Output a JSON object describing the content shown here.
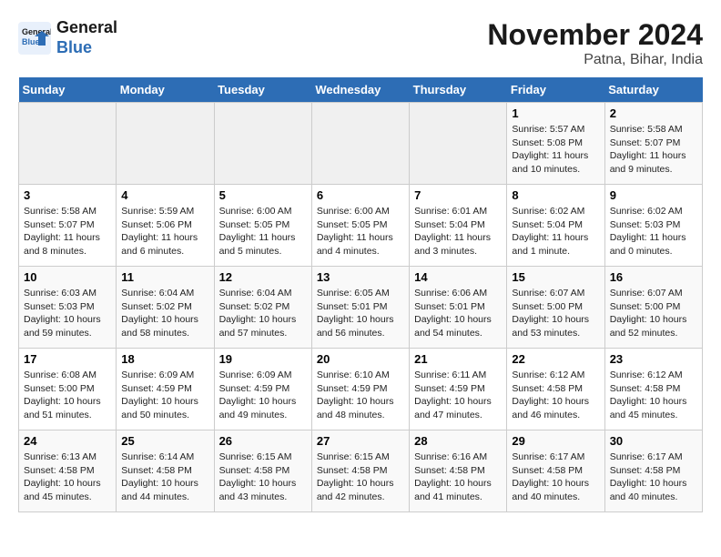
{
  "header": {
    "logo_line1": "General",
    "logo_line2": "Blue",
    "month": "November 2024",
    "location": "Patna, Bihar, India"
  },
  "days_of_week": [
    "Sunday",
    "Monday",
    "Tuesday",
    "Wednesday",
    "Thursday",
    "Friday",
    "Saturday"
  ],
  "weeks": [
    [
      {
        "day": "",
        "empty": true
      },
      {
        "day": "",
        "empty": true
      },
      {
        "day": "",
        "empty": true
      },
      {
        "day": "",
        "empty": true
      },
      {
        "day": "",
        "empty": true
      },
      {
        "day": "1",
        "sunrise": "5:57 AM",
        "sunset": "5:08 PM",
        "daylight": "11 hours and 10 minutes."
      },
      {
        "day": "2",
        "sunrise": "5:58 AM",
        "sunset": "5:07 PM",
        "daylight": "11 hours and 9 minutes."
      }
    ],
    [
      {
        "day": "3",
        "sunrise": "5:58 AM",
        "sunset": "5:07 PM",
        "daylight": "11 hours and 8 minutes."
      },
      {
        "day": "4",
        "sunrise": "5:59 AM",
        "sunset": "5:06 PM",
        "daylight": "11 hours and 6 minutes."
      },
      {
        "day": "5",
        "sunrise": "6:00 AM",
        "sunset": "5:05 PM",
        "daylight": "11 hours and 5 minutes."
      },
      {
        "day": "6",
        "sunrise": "6:00 AM",
        "sunset": "5:05 PM",
        "daylight": "11 hours and 4 minutes."
      },
      {
        "day": "7",
        "sunrise": "6:01 AM",
        "sunset": "5:04 PM",
        "daylight": "11 hours and 3 minutes."
      },
      {
        "day": "8",
        "sunrise": "6:02 AM",
        "sunset": "5:04 PM",
        "daylight": "11 hours and 1 minute."
      },
      {
        "day": "9",
        "sunrise": "6:02 AM",
        "sunset": "5:03 PM",
        "daylight": "11 hours and 0 minutes."
      }
    ],
    [
      {
        "day": "10",
        "sunrise": "6:03 AM",
        "sunset": "5:03 PM",
        "daylight": "10 hours and 59 minutes."
      },
      {
        "day": "11",
        "sunrise": "6:04 AM",
        "sunset": "5:02 PM",
        "daylight": "10 hours and 58 minutes."
      },
      {
        "day": "12",
        "sunrise": "6:04 AM",
        "sunset": "5:02 PM",
        "daylight": "10 hours and 57 minutes."
      },
      {
        "day": "13",
        "sunrise": "6:05 AM",
        "sunset": "5:01 PM",
        "daylight": "10 hours and 56 minutes."
      },
      {
        "day": "14",
        "sunrise": "6:06 AM",
        "sunset": "5:01 PM",
        "daylight": "10 hours and 54 minutes."
      },
      {
        "day": "15",
        "sunrise": "6:07 AM",
        "sunset": "5:00 PM",
        "daylight": "10 hours and 53 minutes."
      },
      {
        "day": "16",
        "sunrise": "6:07 AM",
        "sunset": "5:00 PM",
        "daylight": "10 hours and 52 minutes."
      }
    ],
    [
      {
        "day": "17",
        "sunrise": "6:08 AM",
        "sunset": "5:00 PM",
        "daylight": "10 hours and 51 minutes."
      },
      {
        "day": "18",
        "sunrise": "6:09 AM",
        "sunset": "4:59 PM",
        "daylight": "10 hours and 50 minutes."
      },
      {
        "day": "19",
        "sunrise": "6:09 AM",
        "sunset": "4:59 PM",
        "daylight": "10 hours and 49 minutes."
      },
      {
        "day": "20",
        "sunrise": "6:10 AM",
        "sunset": "4:59 PM",
        "daylight": "10 hours and 48 minutes."
      },
      {
        "day": "21",
        "sunrise": "6:11 AM",
        "sunset": "4:59 PM",
        "daylight": "10 hours and 47 minutes."
      },
      {
        "day": "22",
        "sunrise": "6:12 AM",
        "sunset": "4:58 PM",
        "daylight": "10 hours and 46 minutes."
      },
      {
        "day": "23",
        "sunrise": "6:12 AM",
        "sunset": "4:58 PM",
        "daylight": "10 hours and 45 minutes."
      }
    ],
    [
      {
        "day": "24",
        "sunrise": "6:13 AM",
        "sunset": "4:58 PM",
        "daylight": "10 hours and 45 minutes."
      },
      {
        "day": "25",
        "sunrise": "6:14 AM",
        "sunset": "4:58 PM",
        "daylight": "10 hours and 44 minutes."
      },
      {
        "day": "26",
        "sunrise": "6:15 AM",
        "sunset": "4:58 PM",
        "daylight": "10 hours and 43 minutes."
      },
      {
        "day": "27",
        "sunrise": "6:15 AM",
        "sunset": "4:58 PM",
        "daylight": "10 hours and 42 minutes."
      },
      {
        "day": "28",
        "sunrise": "6:16 AM",
        "sunset": "4:58 PM",
        "daylight": "10 hours and 41 minutes."
      },
      {
        "day": "29",
        "sunrise": "6:17 AM",
        "sunset": "4:58 PM",
        "daylight": "10 hours and 40 minutes."
      },
      {
        "day": "30",
        "sunrise": "6:17 AM",
        "sunset": "4:58 PM",
        "daylight": "10 hours and 40 minutes."
      }
    ]
  ]
}
